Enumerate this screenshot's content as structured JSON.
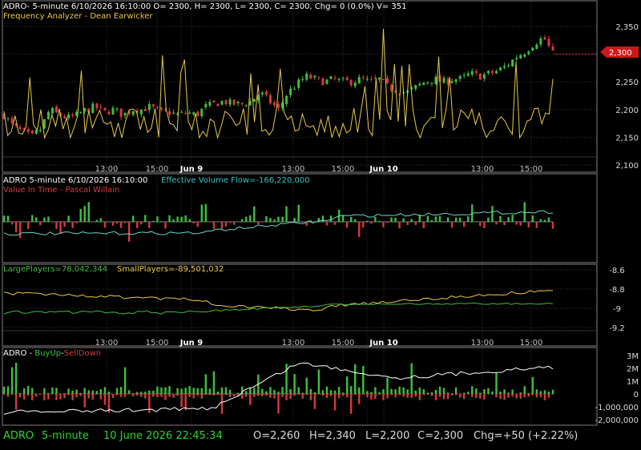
{
  "colors": {
    "background": "#000000",
    "grid": "#333333",
    "frame": "#7f7f7f",
    "up": "#3fbf3f",
    "down": "#d8383e",
    "yellow": "#e6c84a",
    "white": "#ffffff",
    "teal": "#6fd3c6",
    "green_line": "#41b93f",
    "cyan_text": "#3cc0c0",
    "status_green": "#29d629",
    "status_white": "#d9d9d9"
  },
  "panels": {
    "price": {
      "header": "ADRO- 5-minute 6/10/2026 16:10:00 O= 2300, H= 2300, L= 2300, C= 2300, Chg= 0 (0.0%) V= 351",
      "subheader": "Frequency Analyzer - Dean Earwicker",
      "last_price": "2,300"
    },
    "volume": {
      "title": "ADRO 5-minute  6/10/2026 16:10:00",
      "evf": "Effective Volume Flow=-166,220,000",
      "sub": "Value In Time - Pascal Willain"
    },
    "players": {
      "large": "LargePlayers=78,042,344",
      "small": "SmallPlayers=-89,501,032"
    },
    "buyup": {
      "title": "ADRO - ",
      "buy": "BuyUp",
      "dash": "-",
      "sell": "SellDown"
    }
  },
  "axis": {
    "time_ticks": [
      "13:00",
      "15:00",
      "Jun 9",
      "13:00",
      "15:00",
      "Jun 10",
      "13:00",
      "15:00"
    ],
    "day_ticks": [
      "Jun 9",
      "Jun 10"
    ]
  },
  "status_bar": {
    "symbol": "ADRO",
    "interval": "5-minute",
    "datetime": "10 June 2026 22:45:34",
    "open": "O=2,260",
    "high": "H=2,340",
    "low": "L=2,200",
    "close": "C=2,300",
    "change": "Chg=+50 (+2.22%)"
  },
  "chart_data": [
    {
      "type": "candlestick",
      "name": "price",
      "y_ticks": [
        "2,100",
        "2,150",
        "2,200",
        "2,250",
        "2,300",
        "2,350"
      ],
      "ylim": [
        2090,
        2370
      ],
      "x": [
        "Jun 8 13:00",
        "Jun 8 15:00",
        "Jun 9 13:00",
        "Jun 9 15:00",
        "Jun 10 13:00",
        "Jun 10 15:00"
      ],
      "close_path_x_hours": [
        0,
        2,
        4,
        6,
        8,
        10,
        12,
        14,
        16,
        18,
        20,
        22,
        24,
        26,
        28,
        30,
        32,
        34,
        36,
        38,
        40,
        42,
        44,
        46,
        48,
        50,
        52,
        54,
        56,
        58,
        60,
        62,
        64,
        66,
        68,
        70,
        72,
        74,
        76,
        78,
        80,
        82,
        84,
        86,
        88,
        90,
        92,
        94,
        96,
        98,
        100,
        102,
        104,
        106,
        108,
        110,
        112,
        114,
        116,
        118,
        120
      ],
      "close": [
        2190,
        2170,
        2160,
        2150,
        2165,
        2200,
        2190,
        2185,
        2190,
        2200,
        2205,
        2195,
        2200,
        2190,
        2200,
        2200,
        2205,
        2195,
        2195,
        2190,
        2195,
        2190,
        2205,
        2210,
        2215,
        2210,
        2210,
        2215,
        2230,
        2215,
        2200,
        2230,
        2245,
        2260,
        2255,
        2250,
        2255,
        2250,
        2250,
        2255,
        2250,
        2255,
        2240,
        2235,
        2230,
        2240,
        2250,
        2255,
        2250,
        2255,
        2255,
        2265,
        2260,
        2265,
        2270,
        2280,
        2295,
        2305,
        2320,
        2330,
        2300
      ],
      "last": 2300,
      "oscillator": "Frequency Analyzer (yellow, unscaled)"
    },
    {
      "type": "bar+line",
      "name": "Effective Volume Flow",
      "value": -166220000,
      "series": [
        {
          "name": "Effective Volume Flow",
          "kind": "bar"
        },
        {
          "name": "Value In Time",
          "kind": "line"
        }
      ]
    },
    {
      "type": "line",
      "name": "players",
      "y_ticks": [
        "-8.6",
        "-8.8",
        "-9",
        "-9.2"
      ],
      "ylim": [
        -9.3,
        -8.5
      ],
      "series": [
        {
          "name": "LargePlayers",
          "value": 78042344
        },
        {
          "name": "SmallPlayers",
          "value": -89501032
        }
      ]
    },
    {
      "type": "bar+line",
      "name": "BuyUp-SellDown",
      "y_ticks": [
        "3M",
        "2M",
        "1M",
        "0",
        "-1,000,000",
        "-2,000,000"
      ],
      "ylim": [
        -2500000,
        3300000
      ],
      "series": [
        {
          "name": "BuyUp",
          "kind": "bar"
        },
        {
          "name": "SellDown",
          "kind": "bar"
        }
      ]
    }
  ]
}
